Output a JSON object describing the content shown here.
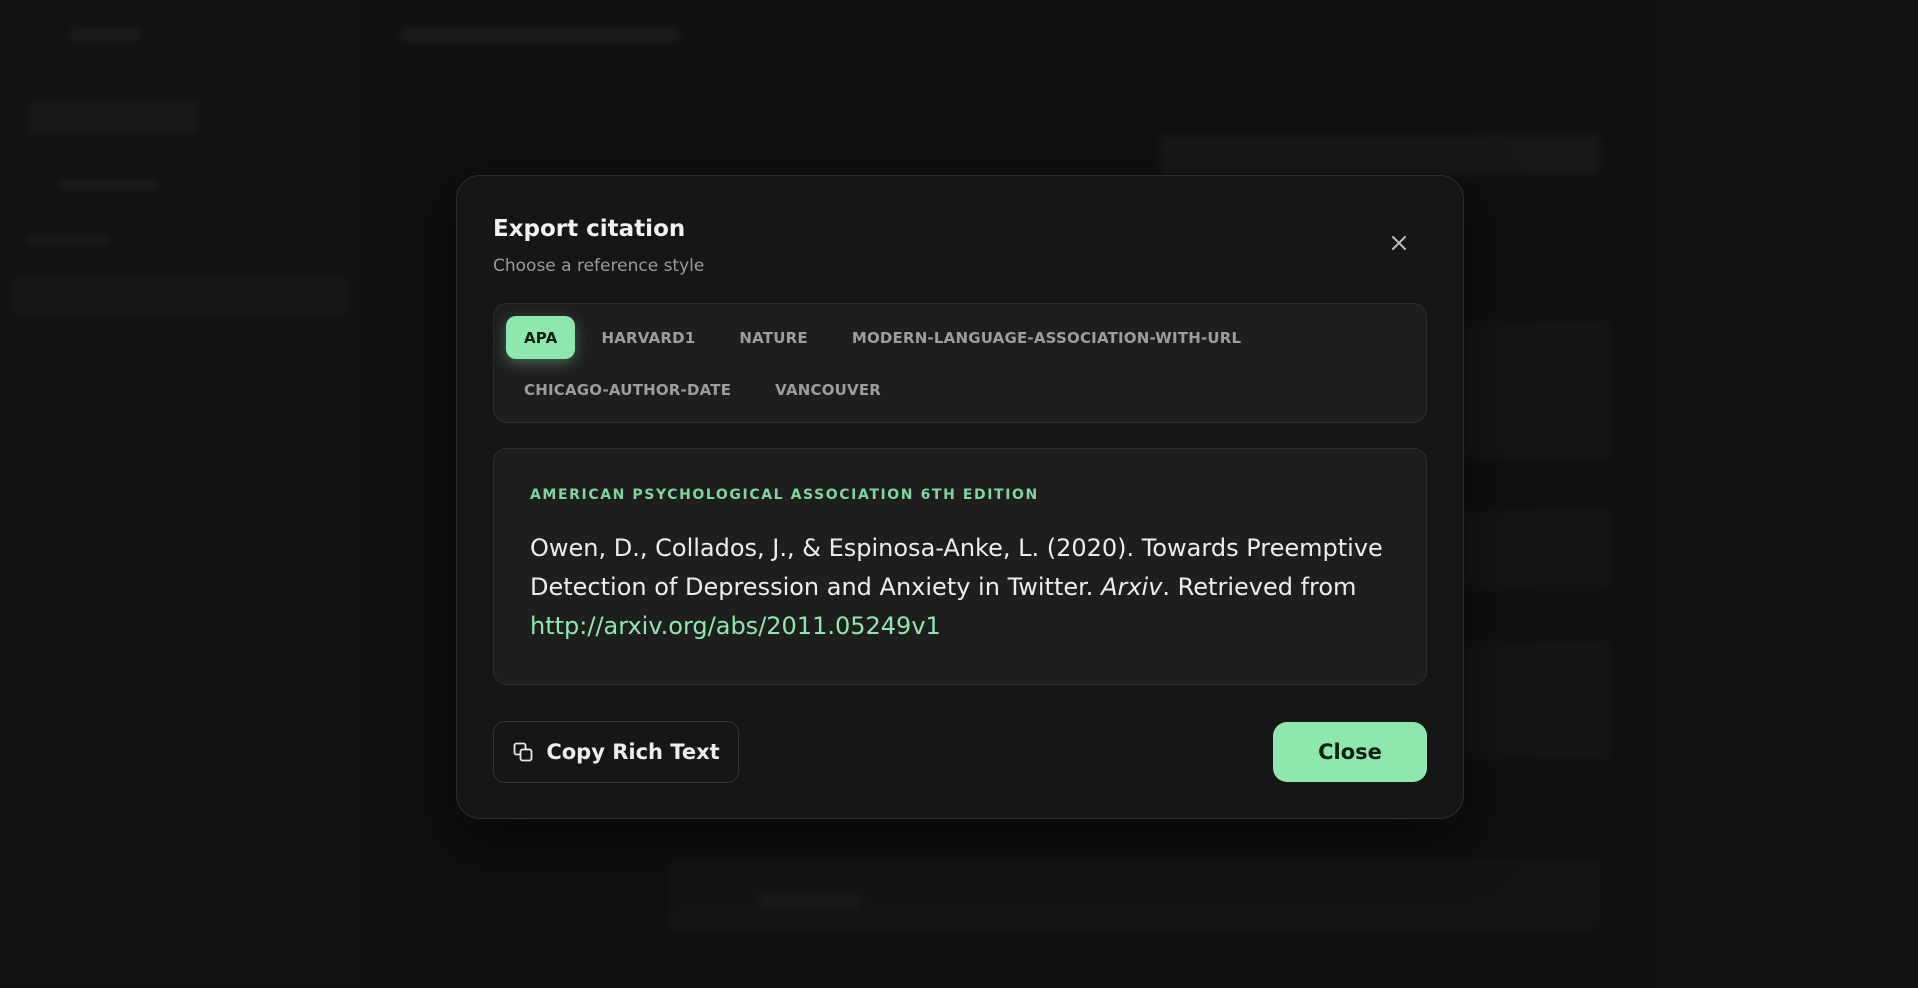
{
  "modal": {
    "title": "Export citation",
    "subtitle": "Choose a reference style"
  },
  "styles": {
    "selected": "APA",
    "tabs": [
      "APA",
      "HARVARD1",
      "NATURE",
      "MODERN-LANGUAGE-ASSOCIATION-WITH-URL",
      "CHICAGO-AUTHOR-DATE",
      "VANCOUVER"
    ]
  },
  "citation": {
    "style_full_name": "AMERICAN PSYCHOLOGICAL ASSOCIATION 6TH EDITION",
    "text_before": "Owen, D., Collados, J., & Espinosa-Anke, L. (2020). Towards Preemptive Detection of Depression and Anxiety in Twitter. ",
    "journal": "Arxiv",
    "text_after": ". Retrieved from ",
    "url": "http://arxiv.org/abs/2011.05249v1"
  },
  "actions": {
    "copy_label": "Copy Rich Text",
    "close_label": "Close"
  },
  "icons": {
    "close": "close-icon",
    "copy": "copy-icon"
  },
  "colors": {
    "accent": "#8ee8ad",
    "accent_text": "#0d1f13",
    "background": "#1b1b1b",
    "modal": "#161616"
  }
}
